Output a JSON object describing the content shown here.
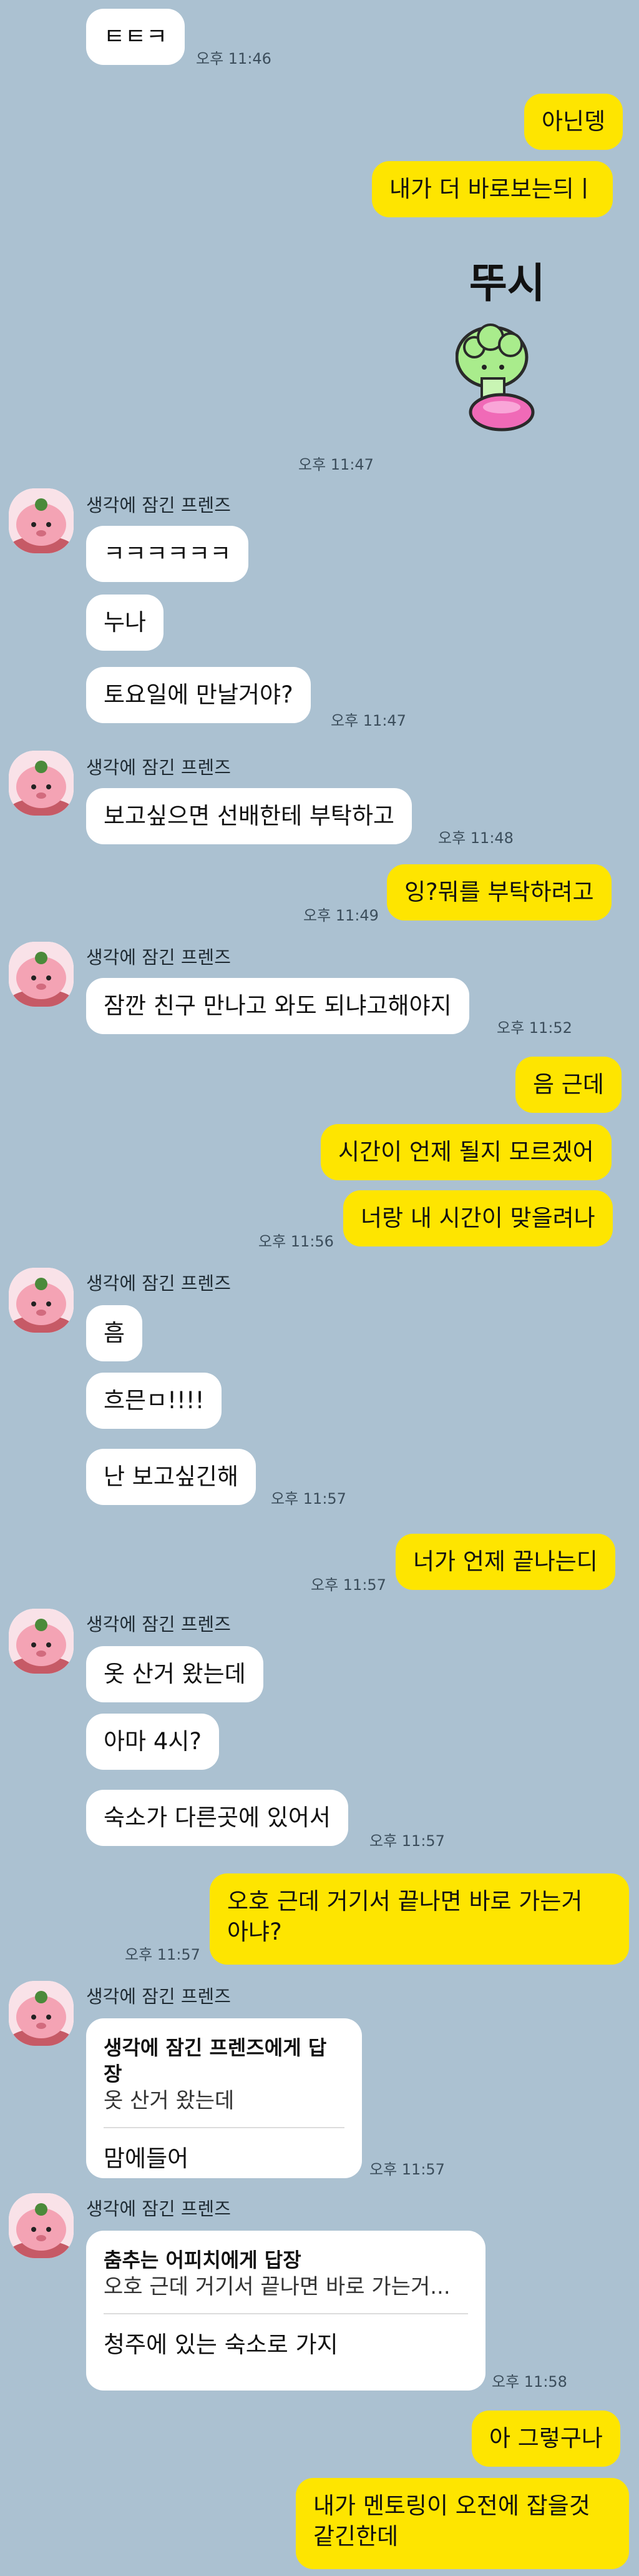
{
  "chat": {
    "sender_name": "생각에 잠긴 프렌즈",
    "messages": [
      {
        "text": "ㅌㅌㅋ",
        "time": "오후 11:46"
      },
      {
        "text": "아닌뎅"
      },
      {
        "text": "내가 더 바로보는듸ㅣ"
      },
      {
        "sticker_text": "뚜시",
        "time": "오후 11:47"
      },
      {
        "text": "ㅋㅋㅋㅋㅋㅋ"
      },
      {
        "text": "누나"
      },
      {
        "text": "토요일에 만날거야?",
        "time": "오후 11:47"
      },
      {
        "text": "보고싶으면 선배한테 부탁하고",
        "time": "오후 11:48"
      },
      {
        "text": "잉?뭐를 부탁하려고",
        "time": "오후 11:49"
      },
      {
        "text": "잠깐 친구 만나고 와도 되냐고해야지",
        "time": "오후 11:52"
      },
      {
        "text": "음 근데"
      },
      {
        "text": "시간이 언제 될지 모르겠어"
      },
      {
        "text": "너랑 내 시간이 맞을려나",
        "time": "오후 11:56"
      },
      {
        "text": "흠"
      },
      {
        "text": "흐믄ㅁ!!!!"
      },
      {
        "text": "난 보고싶긴해",
        "time": "오후 11:57"
      },
      {
        "text": "너가 언제 끝나는디",
        "time": "오후 11:57"
      },
      {
        "text": "옷 산거 왔는데"
      },
      {
        "text": "아마 4시?"
      },
      {
        "text": "숙소가 다른곳에 있어서",
        "time": "오후 11:57"
      },
      {
        "text_line1": "오호 근데 거기서 끝나면 바로 가는거",
        "text_line2": "아냐?",
        "time": "오후 11:57"
      },
      {
        "reply_to": "생각에 잠긴 프렌즈에게 답장",
        "quote": "옷 산거 왔는데",
        "text": "맘에들어",
        "time": "오후 11:57"
      },
      {
        "reply_to": "춤추는 어피치에게 답장",
        "quote": "오호 근데 거기서 끝나면 바로 가는거...",
        "text": "청주에 있는 숙소로 가지",
        "time": "오후 11:58"
      },
      {
        "text": "아 그렇구나"
      },
      {
        "text_line1": "내가 멘토링이 오전에 잡을것",
        "text_line2": "같긴한데"
      }
    ]
  },
  "colors": {
    "background": "#abc1d1",
    "my_bubble": "#fee500",
    "their_bubble": "#ffffff",
    "avatar_accent": "#f4a3b4"
  }
}
